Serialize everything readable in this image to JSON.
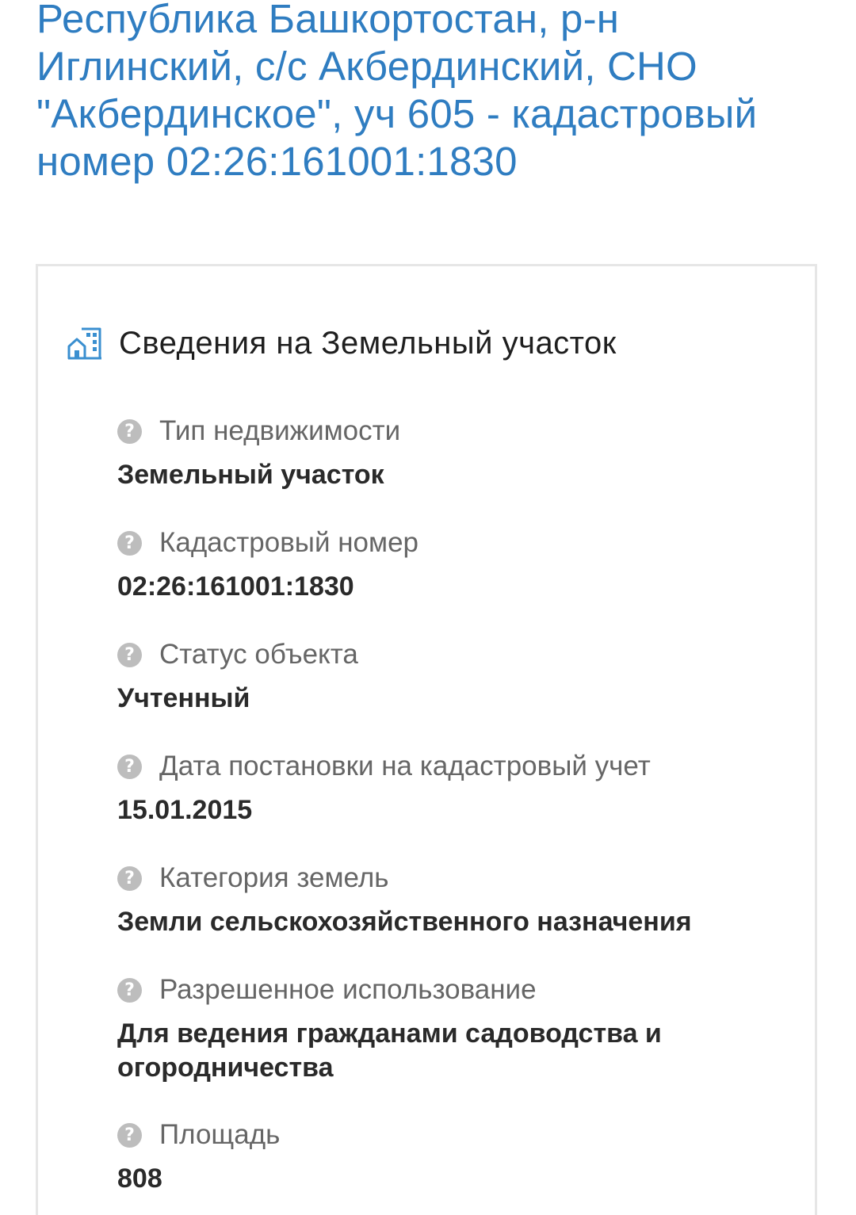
{
  "page": {
    "title": "Республика Башкортостан, р-н Иглинский, с/с Акбердинский, СНО \"Акбердинское\", уч 605 - кадастровый номер 02:26:161001:1830"
  },
  "card": {
    "icon": "building-icon",
    "title": "Сведения на Земельный участок",
    "fields": [
      {
        "label": "Тип недвижимости",
        "value": "Земельный участок"
      },
      {
        "label": "Кадастровый номер",
        "value": "02:26:161001:1830"
      },
      {
        "label": "Статус объекта",
        "value": "Учтенный"
      },
      {
        "label": "Дата постановки на кадастровый учет",
        "value": "15.01.2015"
      },
      {
        "label": "Категория земель",
        "value": "Земли сельскохозяйственного назначения"
      },
      {
        "label": "Разрешенное использование",
        "value": "Для ведения гражданами садоводства и огородничества"
      },
      {
        "label": "Площадь",
        "value": "808"
      }
    ]
  },
  "colors": {
    "title_blue": "#2f7dc1",
    "help_icon_gray": "#bdbdbd",
    "card_border": "#e6e6e6"
  },
  "help_icon_glyph": "?"
}
